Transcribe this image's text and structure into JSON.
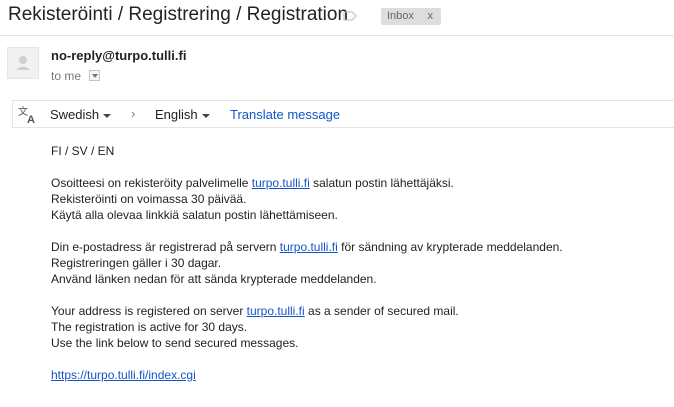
{
  "header": {
    "subject": "Rekisteröinti / Registrering / Registration",
    "label_badge": "Inbox",
    "label_remove": "x"
  },
  "message": {
    "sender": "no-reply@turpo.tulli.fi",
    "recipient_prefix": "to me"
  },
  "translate_bar": {
    "source_language": "Swedish",
    "arrow": "›",
    "target_language": "English",
    "action_link": "Translate message"
  },
  "body": {
    "languages_line": "FI / SV / EN",
    "finnish": {
      "line1_pre": "Osoitteesi on rekisteröity palvelimelle ",
      "line1_link": "turpo.tulli.fi",
      "line1_post": " salatun postin lähettäjäksi.",
      "line2": "Rekisteröinti on voimassa 30 päivää.",
      "line3": "Käytä alla olevaa linkkiä salatun postin lähettämiseen."
    },
    "swedish": {
      "line1_pre": "Din e-postadress är registrerad på servern ",
      "line1_link": "turpo.tulli.fi",
      "line1_post": " för sändning av krypterade meddelanden.",
      "line2": "Registreringen gäller i 30 dagar.",
      "line3": "Använd länken nedan för att sända krypterade meddelanden."
    },
    "english": {
      "line1_pre": "Your address is registered on server ",
      "line1_link": "turpo.tulli.fi",
      "line1_post": " as a sender of secured mail.",
      "line2": "The registration is active for 30 days.",
      "line3": "Use the link below to send secured messages."
    },
    "url_link": "https://turpo.tulli.fi/index.cgi"
  },
  "colors": {
    "link": "#1155cc",
    "badge_bg": "#dddddd",
    "text": "#222222"
  },
  "icons": [
    "label-tag-icon",
    "avatar-person-icon",
    "dropdown-arrow-icon",
    "translate-icon",
    "caret-down-icon"
  ]
}
